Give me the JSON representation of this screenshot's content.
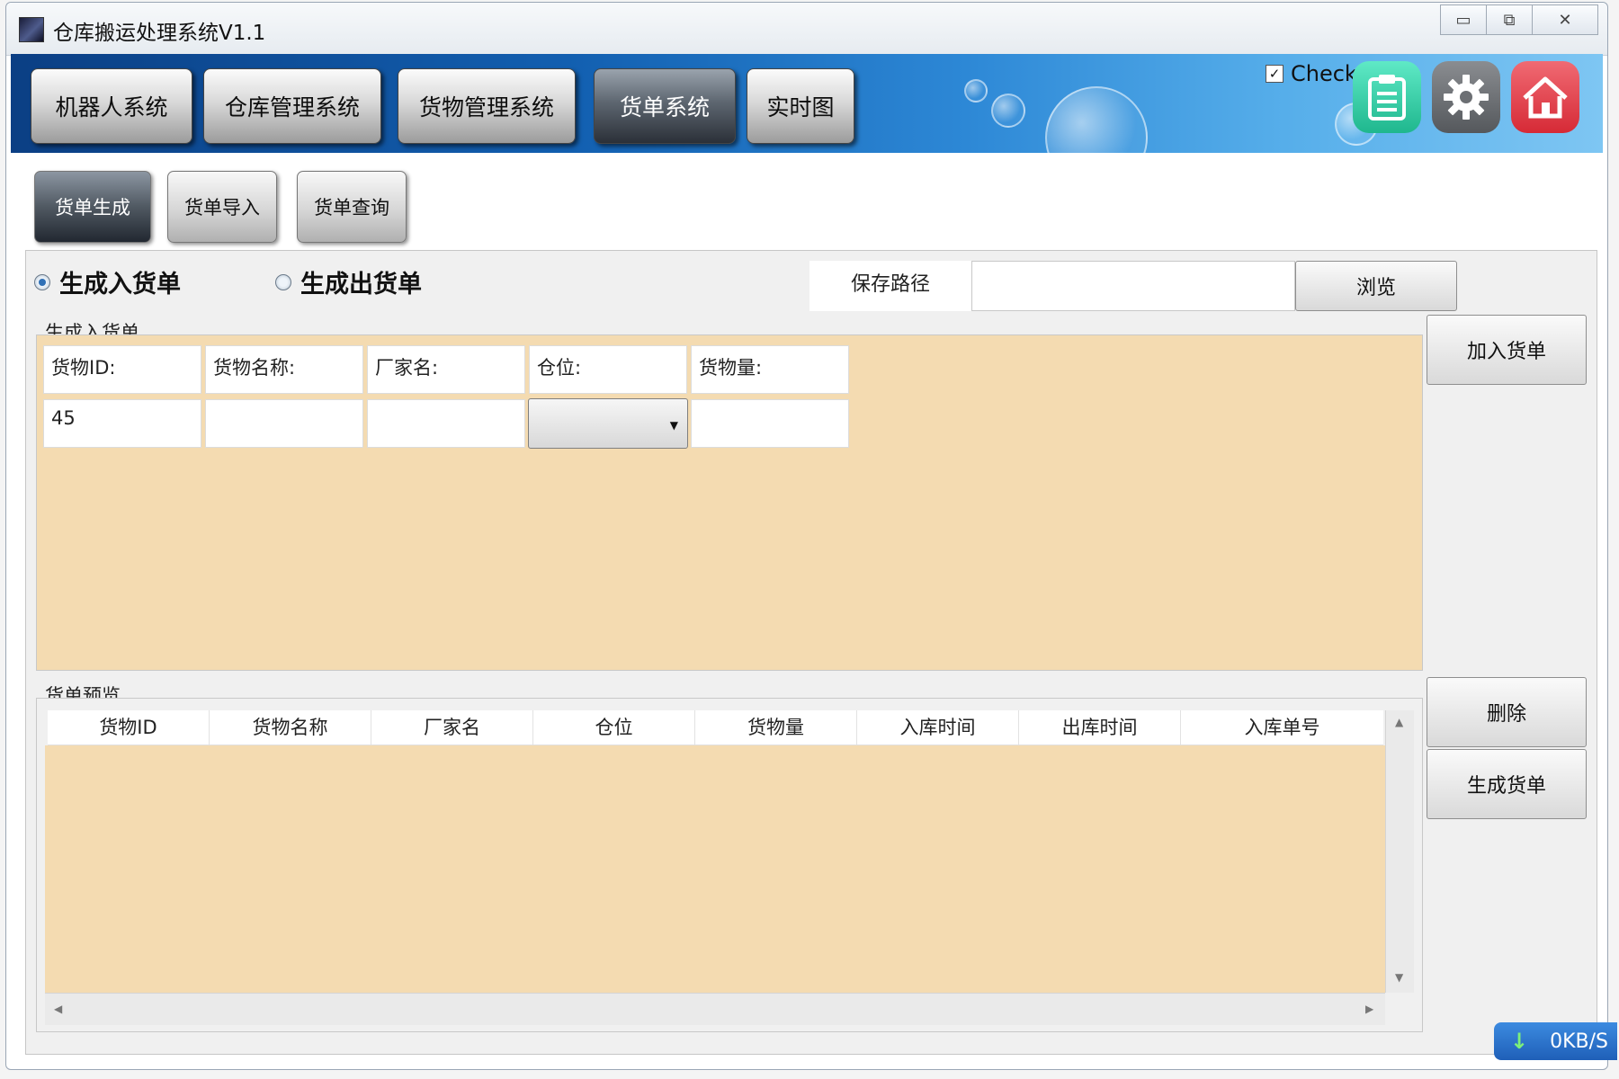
{
  "window": {
    "title": "仓库搬运处理系统V1.1",
    "controls": {
      "minimize": "▭",
      "maximize": "⧉",
      "close": "✕"
    }
  },
  "main_tabs": [
    {
      "label": "机器人系统",
      "active": false
    },
    {
      "label": "仓库管理系统",
      "active": false
    },
    {
      "label": "货物管理系统",
      "active": false
    },
    {
      "label": "货单系统",
      "active": true
    },
    {
      "label": "实时图",
      "active": false
    }
  ],
  "header": {
    "check_label": "Check",
    "check_checked": true,
    "icons": [
      "clipboard-icon",
      "gear-icon",
      "home-icon"
    ],
    "icon_colors": {
      "clipboard": "#2fd1a6",
      "gear": "#6c6f73",
      "home": "#e8404b"
    }
  },
  "sub_tabs": [
    {
      "label": "货单生成",
      "active": true
    },
    {
      "label": "货单导入",
      "active": false
    },
    {
      "label": "货单查询",
      "active": false
    }
  ],
  "mode": {
    "options": [
      {
        "label": "生成入货单",
        "selected": true
      },
      {
        "label": "生成出货单",
        "selected": false
      }
    ]
  },
  "save": {
    "label": "保存路径",
    "value": "",
    "browse_label": "浏览"
  },
  "entry_group": {
    "title": "生成入货单",
    "fields": [
      {
        "label": "货物ID:",
        "value": "45"
      },
      {
        "label": "货物名称:",
        "value": ""
      },
      {
        "label": "厂家名:",
        "value": ""
      },
      {
        "label": "仓位:",
        "value": ""
      },
      {
        "label": "货物量:",
        "value": ""
      }
    ],
    "add_label": "加入货单"
  },
  "preview_group": {
    "title": "货单预览",
    "columns": [
      "货物ID",
      "货物名称",
      "厂家名",
      "仓位",
      "货物量",
      "入库时间",
      "出库时间",
      "入库单号"
    ],
    "rows": [],
    "delete_label": "删除",
    "generate_label": "生成货单"
  },
  "status": {
    "speed": "0KB/S"
  },
  "colors": {
    "accent_blue": "#125fb0",
    "panel_tan": "#f4dbb1"
  }
}
